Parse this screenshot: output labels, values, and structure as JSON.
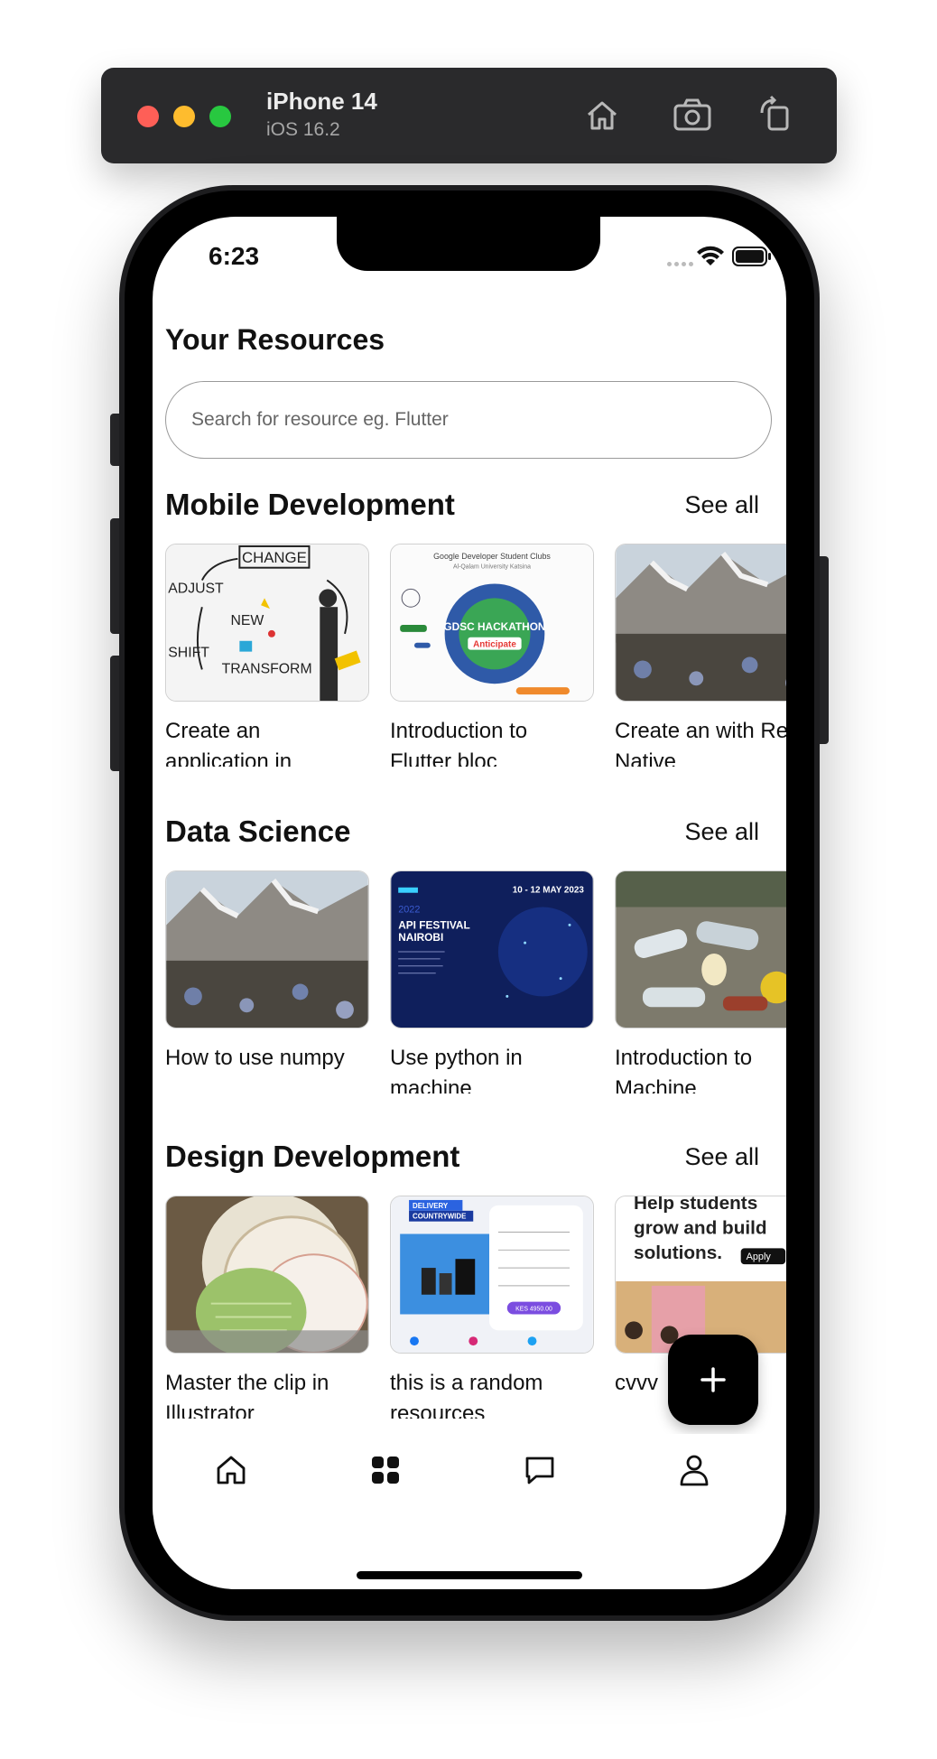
{
  "simulator": {
    "device_name": "iPhone 14",
    "os_version": "iOS 16.2",
    "icons": [
      "home-icon",
      "screenshot-icon",
      "rotate-icon"
    ]
  },
  "status_bar": {
    "time": "6:23",
    "icons": [
      "wifi-icon",
      "battery-icon"
    ]
  },
  "header": {
    "title": "Your Resources"
  },
  "search": {
    "placeholder": "Search for resource eg. Flutter",
    "value": ""
  },
  "sections": [
    {
      "title": "Mobile Development",
      "see_all": "See all",
      "cards": [
        {
          "title": "Create an application in",
          "thumb": "change-whiteboard"
        },
        {
          "title": "Introduction to Flutter bloc",
          "thumb": "gdsc-hackathon"
        },
        {
          "title": "Create an with React Native",
          "thumb": "mountain-waste"
        }
      ]
    },
    {
      "title": "Data Science",
      "see_all": "See all",
      "cards": [
        {
          "title": "How to use numpy",
          "thumb": "mountain-waste"
        },
        {
          "title": "Use python in machine",
          "thumb": "api-festival"
        },
        {
          "title": "Introduction to Machine",
          "thumb": "bottles-beach"
        }
      ]
    },
    {
      "title": "Design Development",
      "see_all": "See all",
      "cards": [
        {
          "title": "Master the clip in Illustrator",
          "thumb": "plates"
        },
        {
          "title": "this is a random resources",
          "thumb": "speaker-ad"
        },
        {
          "title": "cvvv",
          "thumb": "students-poster"
        }
      ]
    }
  ],
  "thumb_text": {
    "change": "CHANGE",
    "adjust": "ADJUST",
    "new": "NEW",
    "shift": "SHIFT",
    "transform": "TRANSFORM",
    "gdsc_header": "Google Developer Student Clubs",
    "gdsc_sub": "Al-Qalam University Katsina",
    "gdsc_main": "GDSC HACKATHON",
    "gdsc_tag": "Anticipate",
    "api_date": "10 - 12 MAY 2023",
    "api_year": "2022",
    "api_title1": "API FESTIVAL",
    "api_title2": "NAIROBI",
    "delivery1": "DELIVERY",
    "delivery2": "COUNTRYWIDE",
    "speaker_price": "KES 4950.00",
    "poster1": "Help students",
    "poster2": "grow and build",
    "poster3": "solutions.",
    "poster_apply": "Apply"
  },
  "fab": {
    "icon": "plus-icon"
  },
  "bottom_nav": {
    "items": [
      "home-icon",
      "grid-icon",
      "chat-icon",
      "profile-icon"
    ]
  },
  "colors": {
    "accent": "#000000",
    "background": "#ffffff",
    "text": "#111111"
  }
}
